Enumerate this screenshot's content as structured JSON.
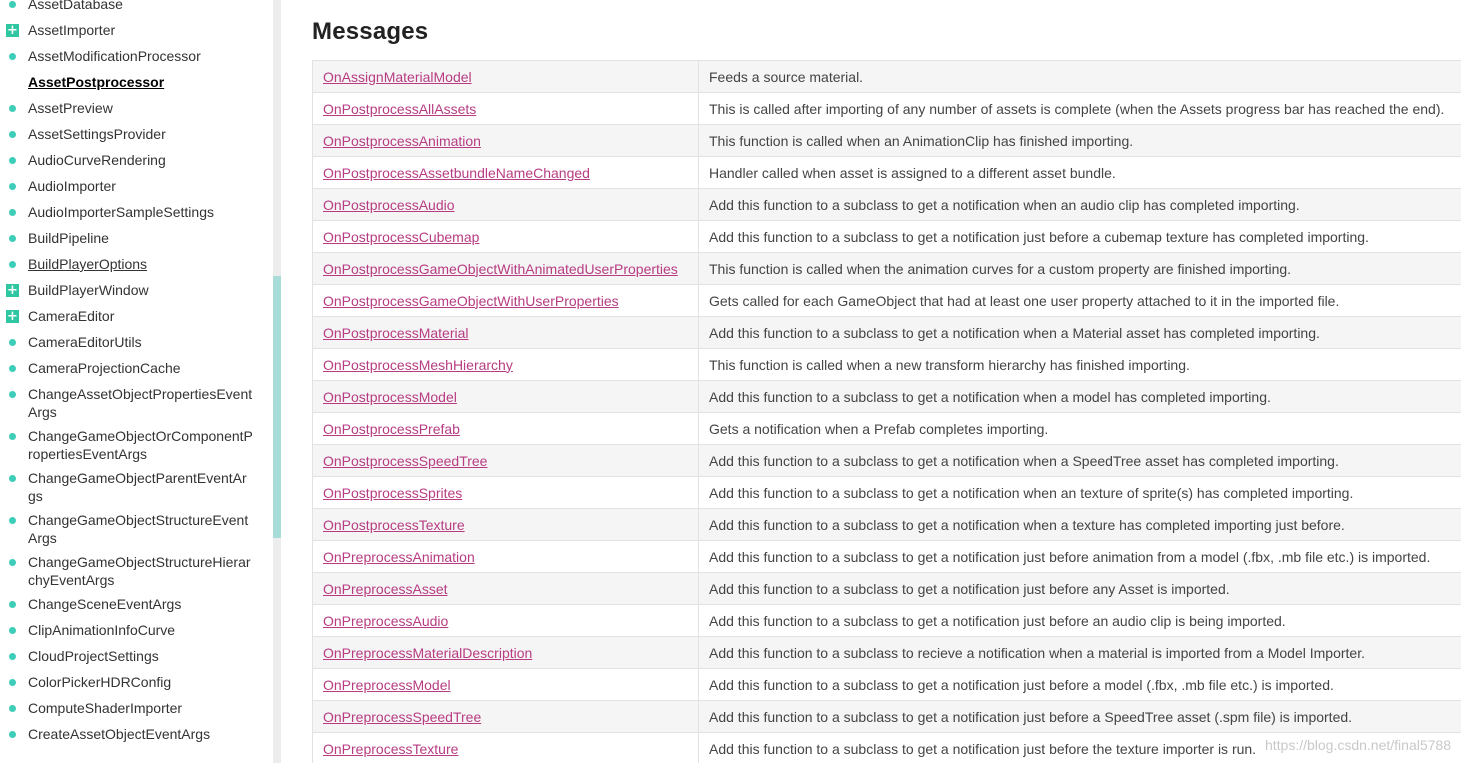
{
  "sidebar": {
    "items": [
      {
        "label": "AssetDatabase",
        "marker": "dot"
      },
      {
        "label": "AssetImporter",
        "marker": "plus"
      },
      {
        "label": "AssetModificationProcessor",
        "marker": "dot"
      },
      {
        "label": "AssetPostprocessor",
        "marker": "none",
        "state": "current"
      },
      {
        "label": "AssetPreview",
        "marker": "dot"
      },
      {
        "label": "AssetSettingsProvider",
        "marker": "dot"
      },
      {
        "label": "AudioCurveRendering",
        "marker": "dot"
      },
      {
        "label": "AudioImporter",
        "marker": "dot"
      },
      {
        "label": "AudioImporterSampleSettings",
        "marker": "dot"
      },
      {
        "label": "BuildPipeline",
        "marker": "dot"
      },
      {
        "label": "BuildPlayerOptions",
        "marker": "dot",
        "state": "visited"
      },
      {
        "label": "BuildPlayerWindow",
        "marker": "plus"
      },
      {
        "label": "CameraEditor",
        "marker": "plus"
      },
      {
        "label": "CameraEditorUtils",
        "marker": "dot"
      },
      {
        "label": "CameraProjectionCache",
        "marker": "dot"
      },
      {
        "label": "ChangeAssetObjectPropertiesEventArgs",
        "marker": "dot"
      },
      {
        "label": "ChangeGameObjectOrComponentPropertiesEventArgs",
        "marker": "dot"
      },
      {
        "label": "ChangeGameObjectParentEventArgs",
        "marker": "dot"
      },
      {
        "label": "ChangeGameObjectStructureEventArgs",
        "marker": "dot"
      },
      {
        "label": "ChangeGameObjectStructureHierarchyEventArgs",
        "marker": "dot"
      },
      {
        "label": "ChangeSceneEventArgs",
        "marker": "dot"
      },
      {
        "label": "ClipAnimationInfoCurve",
        "marker": "dot"
      },
      {
        "label": "CloudProjectSettings",
        "marker": "dot"
      },
      {
        "label": "ColorPickerHDRConfig",
        "marker": "dot"
      },
      {
        "label": "ComputeShaderImporter",
        "marker": "dot"
      },
      {
        "label": "CreateAssetObjectEventArgs",
        "marker": "dot"
      }
    ]
  },
  "main": {
    "section_title": "Messages",
    "messages": [
      {
        "name": "OnAssignMaterialModel",
        "description": "Feeds a source material."
      },
      {
        "name": "OnPostprocessAllAssets",
        "description": "This is called after importing of any number of assets is complete (when the Assets progress bar has reached the end)."
      },
      {
        "name": "OnPostprocessAnimation",
        "description": "This function is called when an AnimationClip has finished importing."
      },
      {
        "name": "OnPostprocessAssetbundleNameChanged",
        "description": "Handler called when asset is assigned to a different asset bundle."
      },
      {
        "name": "OnPostprocessAudio",
        "description": "Add this function to a subclass to get a notification when an audio clip has completed importing."
      },
      {
        "name": "OnPostprocessCubemap",
        "description": "Add this function to a subclass to get a notification just before a cubemap texture has completed importing."
      },
      {
        "name": "OnPostprocessGameObjectWithAnimatedUserProperties",
        "description": "This function is called when the animation curves for a custom property are finished importing."
      },
      {
        "name": "OnPostprocessGameObjectWithUserProperties",
        "description": "Gets called for each GameObject that had at least one user property attached to it in the imported file."
      },
      {
        "name": "OnPostprocessMaterial",
        "description": "Add this function to a subclass to get a notification when a Material asset has completed importing."
      },
      {
        "name": "OnPostprocessMeshHierarchy",
        "description": "This function is called when a new transform hierarchy has finished importing."
      },
      {
        "name": "OnPostprocessModel",
        "description": "Add this function to a subclass to get a notification when a model has completed importing."
      },
      {
        "name": "OnPostprocessPrefab",
        "description": "Gets a notification when a Prefab completes importing."
      },
      {
        "name": "OnPostprocessSpeedTree",
        "description": "Add this function to a subclass to get a notification when a SpeedTree asset has completed importing."
      },
      {
        "name": "OnPostprocessSprites",
        "description": "Add this function to a subclass to get a notification when an texture of sprite(s) has completed importing."
      },
      {
        "name": "OnPostprocessTexture",
        "description": "Add this function to a subclass to get a notification when a texture has completed importing just before."
      },
      {
        "name": "OnPreprocessAnimation",
        "description": "Add this function to a subclass to get a notification just before animation from a model (.fbx, .mb file etc.) is imported."
      },
      {
        "name": "OnPreprocessAsset",
        "description": "Add this function to a subclass to get a notification just before any Asset is imported."
      },
      {
        "name": "OnPreprocessAudio",
        "description": "Add this function to a subclass to get a notification just before an audio clip is being imported."
      },
      {
        "name": "OnPreprocessMaterialDescription",
        "description": "Add this function to a subclass to recieve a notification when a material is imported from a Model Importer."
      },
      {
        "name": "OnPreprocessModel",
        "description": "Add this function to a subclass to get a notification just before a model (.fbx, .mb file etc.) is imported."
      },
      {
        "name": "OnPreprocessSpeedTree",
        "description": "Add this function to a subclass to get a notification just before a SpeedTree asset (.spm file) is imported."
      },
      {
        "name": "OnPreprocessTexture",
        "description": "Add this function to a subclass to get a notification just before the texture importer is run."
      }
    ]
  },
  "watermark": "https://blog.csdn.net/final5788",
  "colors": {
    "link": "#b83c82",
    "bullet": "#3dcdb9",
    "plus_box": "#2fc7a2",
    "scroll_thumb": "#a8dcd8"
  }
}
